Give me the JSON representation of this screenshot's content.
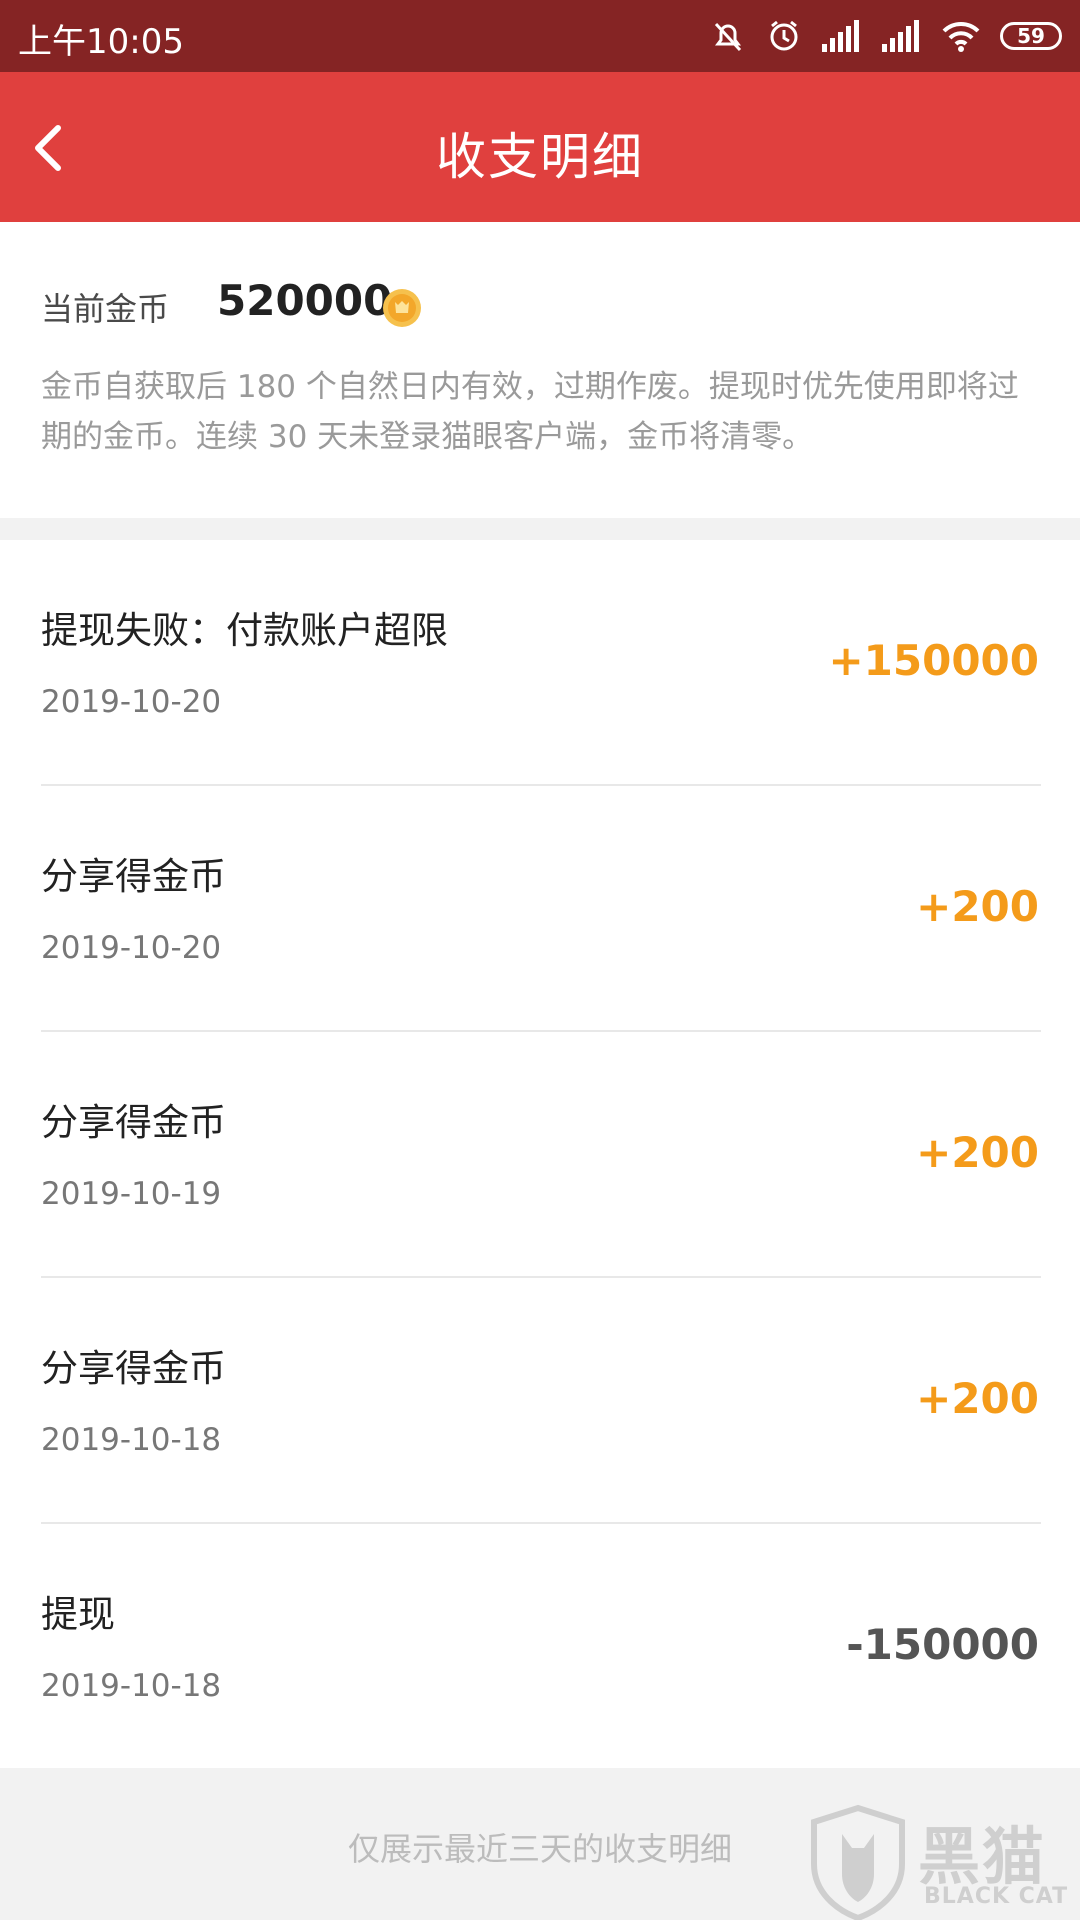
{
  "status_bar": {
    "time": "上午10:05",
    "battery": "59"
  },
  "header": {
    "title": "收支明细"
  },
  "summary": {
    "label": "当前金币",
    "value": "520000",
    "notice": "金币自获取后 180 个自然日内有效，过期作废。提现时优先使用即将过期的金币。连续 30 天未登录猫眼客户端，金币将清零。"
  },
  "transactions": [
    {
      "title": "提现失败：付款账户超限",
      "date": "2019-10-20",
      "amount": "+150000"
    },
    {
      "title": "分享得金币",
      "date": "2019-10-20",
      "amount": "+200"
    },
    {
      "title": "分享得金币",
      "date": "2019-10-19",
      "amount": "+200"
    },
    {
      "title": "分享得金币",
      "date": "2019-10-18",
      "amount": "+200"
    },
    {
      "title": "提现",
      "date": "2019-10-18",
      "amount": "-150000"
    }
  ],
  "footer": {
    "text": "仅展示最近三天的收支明细"
  },
  "watermark": {
    "title": "黑猫",
    "subtitle": "BLACK CAT"
  },
  "colors": {
    "status_bar": "#852424",
    "header": "#e0403e",
    "income": "#f49b1a",
    "expense": "#555555"
  }
}
